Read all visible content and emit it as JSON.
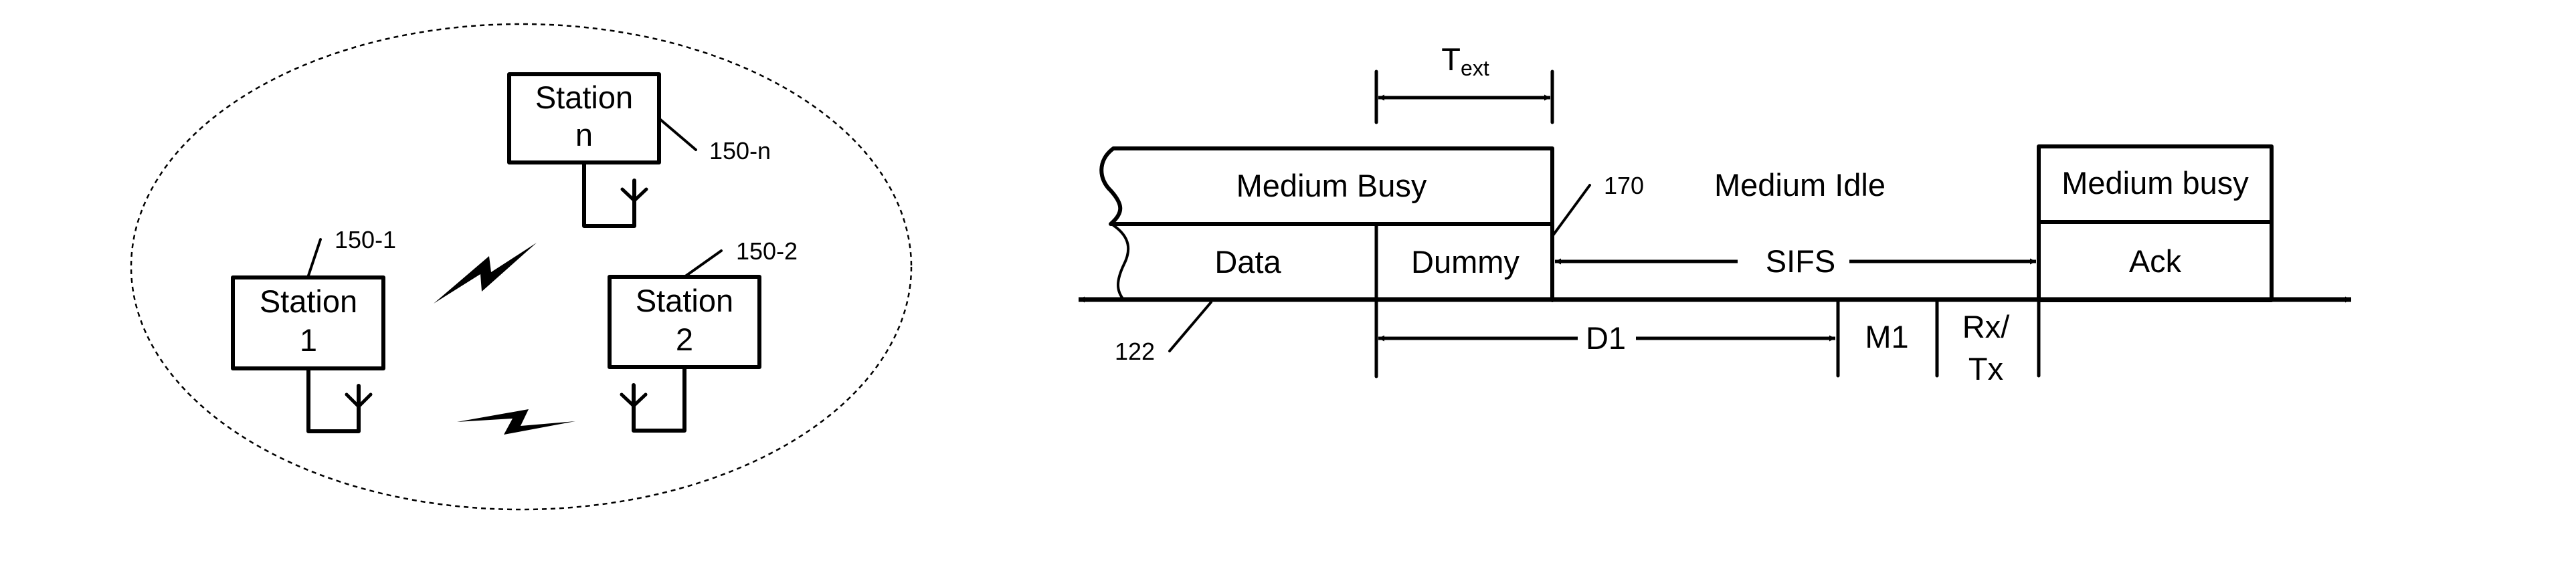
{
  "network": {
    "boundary": "dashed-ellipse",
    "stations": [
      {
        "id": "station-1",
        "line1": "Station",
        "line2": "1",
        "ref": "150-1"
      },
      {
        "id": "station-2",
        "line1": "Station",
        "line2": "2",
        "ref": "150-2"
      },
      {
        "id": "station-n",
        "line1": "Station",
        "line2": "n",
        "ref": "150-n"
      }
    ],
    "links": [
      "wireless-link-1-n",
      "wireless-link-1-2"
    ],
    "icons": {
      "antenna": "antenna-icon",
      "link": "lightning-bolt-icon"
    }
  },
  "timing": {
    "t_ext": {
      "main": "T",
      "sub": "ext"
    },
    "medium_busy": "Medium Busy",
    "data": "Data",
    "dummy": "Dummy",
    "ref_170": "170",
    "medium_idle": "Medium Idle",
    "sifs": "SIFS",
    "medium_busy_2": "Medium busy",
    "ack": "Ack",
    "d1": "D1",
    "m1": "M1",
    "rxtx_line1": "Rx/",
    "rxtx_line2": "Tx",
    "ref_122": "122"
  },
  "colors": {
    "ink": "#000000",
    "background": "#ffffff"
  }
}
